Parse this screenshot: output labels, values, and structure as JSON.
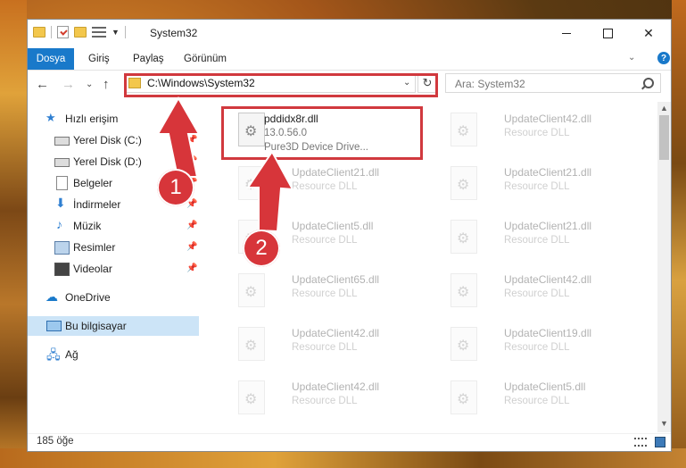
{
  "window": {
    "title": "System32",
    "controls": {
      "minimize": "",
      "maximize": "",
      "close": "✕"
    }
  },
  "ribbon": {
    "tabs": [
      "Dosya",
      "Giriş",
      "Paylaş",
      "Görünüm"
    ],
    "expand": "⌄",
    "help": "?"
  },
  "navigation": {
    "back": "←",
    "forward": "→",
    "recent": "⌄",
    "up": "↑",
    "address": "C:\\Windows\\System32",
    "address_dropdown": "⌄",
    "refresh": "↻",
    "search_placeholder": "Ara: System32"
  },
  "sidebar": {
    "items": [
      {
        "label": "Hızlı erişim",
        "icon": "star-icon",
        "pinned": false
      },
      {
        "label": "Yerel Disk (C:)",
        "icon": "drive-icon",
        "pinned": true
      },
      {
        "label": "Yerel Disk (D:)",
        "icon": "drive-icon",
        "pinned": true
      },
      {
        "label": "Belgeler",
        "icon": "document-icon",
        "pinned": true
      },
      {
        "label": "İndirmeler",
        "icon": "download-icon",
        "pinned": true
      },
      {
        "label": "Müzik",
        "icon": "music-icon",
        "pinned": true
      },
      {
        "label": "Resimler",
        "icon": "pictures-icon",
        "pinned": true
      },
      {
        "label": "Videolar",
        "icon": "video-icon",
        "pinned": true
      },
      {
        "label": "OneDrive",
        "icon": "onedrive-icon",
        "pinned": false
      },
      {
        "label": "Bu bilgisayar",
        "icon": "computer-icon",
        "pinned": false
      },
      {
        "label": "Ağ",
        "icon": "network-icon",
        "pinned": false
      }
    ],
    "pin_glyph": "📌"
  },
  "files": [
    {
      "name": "pddidx8r.dll",
      "version": "13.0.56.0",
      "description": "Pure3D Device Drive...",
      "faded": false
    },
    {
      "name": "UpdateClient42.dll",
      "type": "Resource DLL",
      "faded": true
    },
    {
      "name": "UpdateClient21.dll",
      "type": "Resource DLL",
      "faded": true
    },
    {
      "name": "UpdateClient21.dll",
      "type": "Resource DLL",
      "faded": true
    },
    {
      "name": "UpdateClient5.dll",
      "type": "Resource DLL",
      "faded": true
    },
    {
      "name": "UpdateClient21.dll",
      "type": "Resource DLL",
      "faded": true
    },
    {
      "name": "UpdateClient65.dll",
      "type": "Resource DLL",
      "faded": true
    },
    {
      "name": "UpdateClient42.dll",
      "type": "Resource DLL",
      "faded": true
    },
    {
      "name": "UpdateClient42.dll",
      "type": "Resource DLL",
      "faded": true
    },
    {
      "name": "UpdateClient19.dll",
      "type": "Resource DLL",
      "faded": true
    },
    {
      "name": "UpdateClient42.dll",
      "type": "Resource DLL",
      "faded": true
    },
    {
      "name": "UpdateClient5.dll",
      "type": "Resource DLL",
      "faded": true
    }
  ],
  "status": {
    "item_count": "185 öğe"
  },
  "annotations": {
    "marker1": "1",
    "marker2": "2",
    "color": "#d1393e"
  },
  "colors": {
    "accent": "#1979ca",
    "selection": "#cce4f7"
  }
}
